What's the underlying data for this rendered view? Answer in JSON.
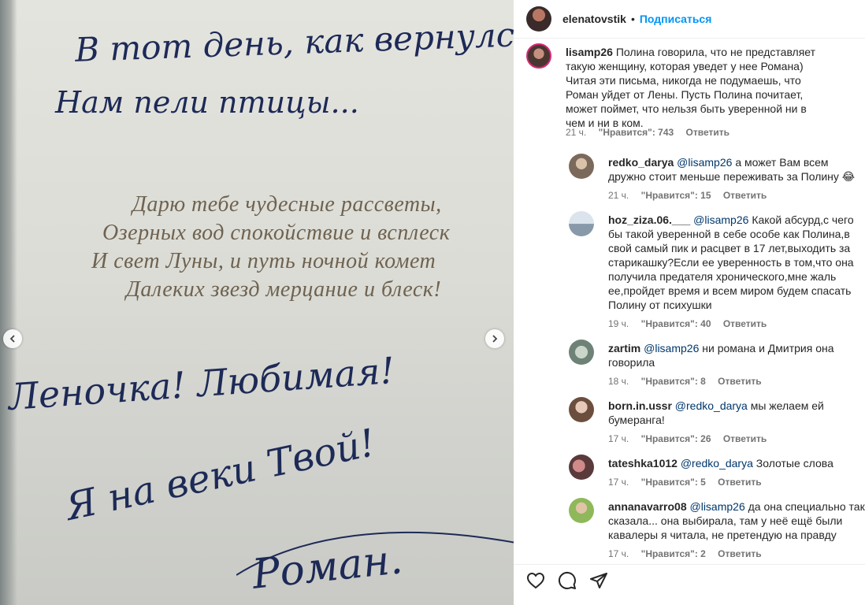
{
  "photo": {
    "hand_line1": "В тот день, как вернулся я",
    "hand_line2": "Нам пели птицы...",
    "poem": [
      "Дарю тебе чудесные рассветы,",
      "Озерных вод спокойствие и всплеск",
      "И свет Луны, и путь ночной комет",
      "Далеких звезд мерцание и блеск!"
    ],
    "hand_line3": "Леночка! Любимая!",
    "hand_line4": "Я на веки Твой!",
    "signature": "Роман."
  },
  "header": {
    "username": "elenatovstik",
    "separator": "•",
    "follow_label": "Подписаться"
  },
  "caption": {
    "username": "lisamp26",
    "text": "Полина говорила, что не представляет такую женщину, которая уведет у нее Романа) Читая эти письма, никогда не подумаешь, что Роман уйдет от Лены. Пусть Полина почитает, может поймет, что нельзя быть уверенной ни в чем и ни в ком.",
    "time": "21 ч.",
    "likes": "\"Нравится\": 743",
    "reply": "Ответить"
  },
  "replies": [
    {
      "username": "redko_darya",
      "mention": "@lisamp26",
      "text": "а может Вам всем дружно стоит меньше переживать за Полину 😂",
      "time": "21 ч.",
      "likes": "\"Нравится\": 15",
      "reply": "Ответить"
    },
    {
      "username": "hoz_ziza.06.___",
      "mention": "@lisamp26",
      "text": "Какой абсурд,с чего бы такой уверенной в себе особе как Полина,в свой самый пик и расцвет в 17 лет,выходить за старикашку?Если ее уверенность в том,что она получила предателя хронического,мне жаль ее,пройдет время и всем миром будем спасать Полину от психушки",
      "time": "19 ч.",
      "likes": "\"Нравится\": 40",
      "reply": "Ответить"
    },
    {
      "username": "zartim",
      "mention": "@lisamp26",
      "text": "ни романа и Дмитрия она говорила",
      "time": "18 ч.",
      "likes": "\"Нравится\": 8",
      "reply": "Ответить"
    },
    {
      "username": "born.in.ussr",
      "mention": "@redko_darya",
      "text": "мы желаем ей бумеранга!",
      "time": "17 ч.",
      "likes": "\"Нравится\": 26",
      "reply": "Ответить"
    },
    {
      "username": "tateshka1012",
      "mention": "@redko_darya",
      "text": "Золотые слова",
      "time": "17 ч.",
      "likes": "\"Нравится\": 5",
      "reply": "Ответить"
    },
    {
      "username": "annanavarro08",
      "mention": "@lisamp26",
      "text": "да она специально так сказала... она выбирала, там у неё ещё были кавалеры я читала, не претендую на правду",
      "time": "17 ч.",
      "likes": "\"Нравится\": 2",
      "reply": "Ответить"
    }
  ],
  "icons": {
    "like": "heart-icon",
    "comment": "comment-icon",
    "share": "share-icon",
    "prev": "chevron-left-icon",
    "next": "chevron-right-icon"
  }
}
